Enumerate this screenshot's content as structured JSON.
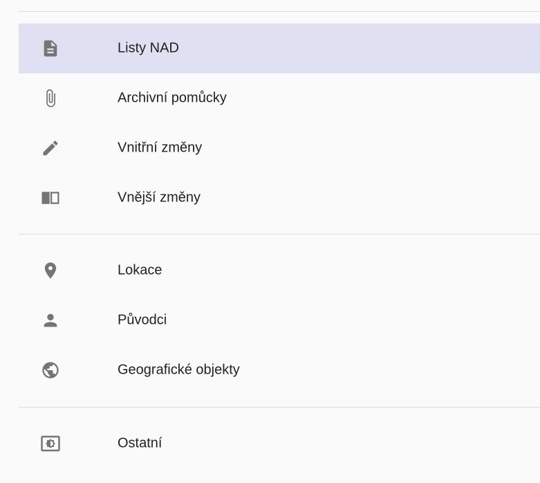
{
  "menu": {
    "items": [
      {
        "label": "Listy NAD",
        "icon": "document-icon",
        "active": true
      },
      {
        "label": "Archivní pomůcky",
        "icon": "paperclip-icon",
        "active": false
      },
      {
        "label": "Vnitřní změny",
        "icon": "pencil-icon",
        "active": false
      },
      {
        "label": "Vnější změny",
        "icon": "book-icon",
        "active": false
      },
      {
        "label": "Lokace",
        "icon": "location-pin-icon",
        "active": false
      },
      {
        "label": "Původci",
        "icon": "person-icon",
        "active": false
      },
      {
        "label": "Geografické objekty",
        "icon": "globe-icon",
        "active": false
      },
      {
        "label": "Ostatní",
        "icon": "settings-brightness-icon",
        "active": false
      }
    ]
  },
  "colors": {
    "active_background": "#dfe1f2",
    "icon": "#757575",
    "text": "#212121",
    "divider": "#dcdcdc"
  }
}
